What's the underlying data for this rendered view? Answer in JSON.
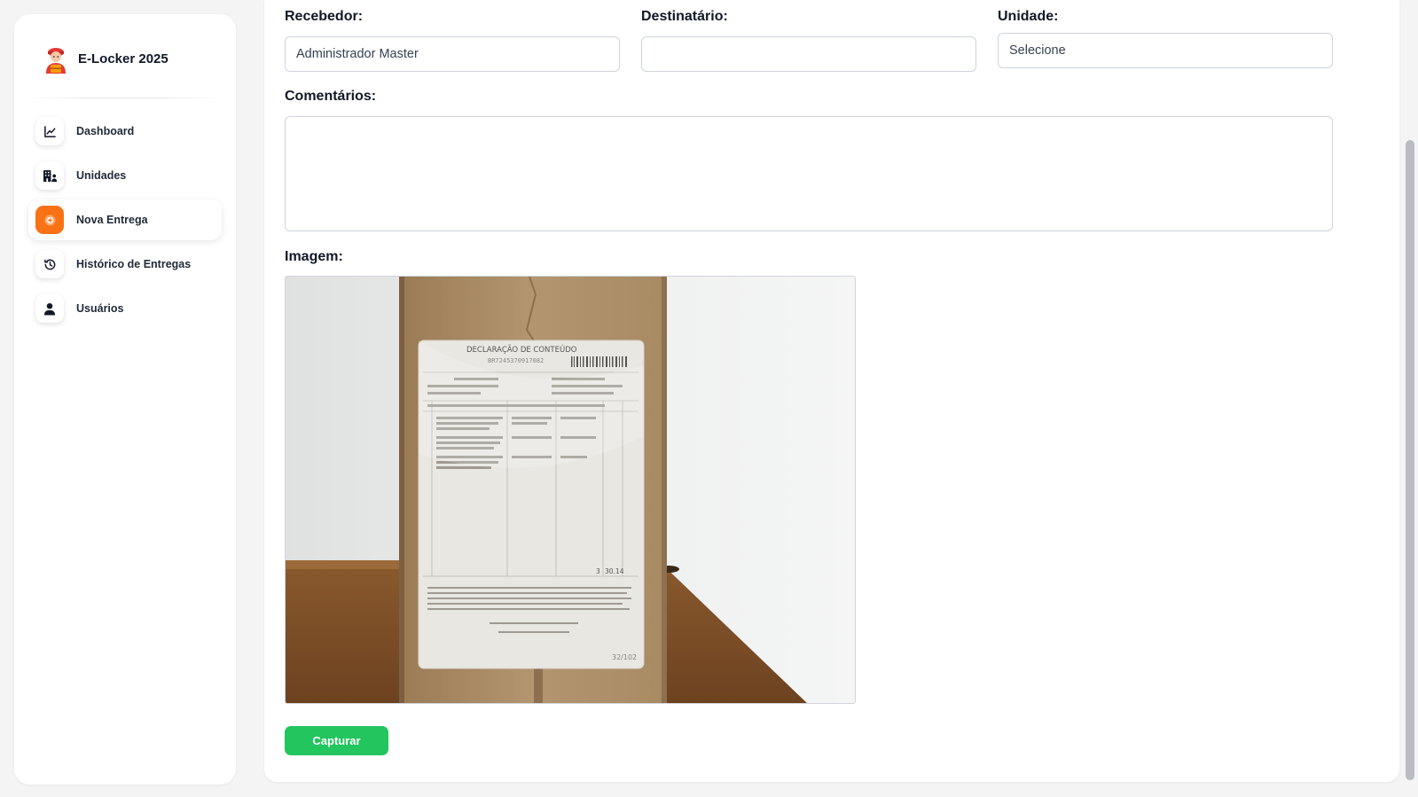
{
  "sidebar": {
    "brand": {
      "title": "E-Locker 2025",
      "logo_icon": "delivery-person-icon"
    },
    "items": [
      {
        "label": "Dashboard",
        "icon": "chart-line-icon",
        "active": false
      },
      {
        "label": "Unidades",
        "icon": "building-users-icon",
        "active": false
      },
      {
        "label": "Nova Entrega",
        "icon": "plus-circle-icon",
        "active": true
      },
      {
        "label": "Histórico de Entregas",
        "icon": "history-icon",
        "active": false
      },
      {
        "label": "Usuários",
        "icon": "user-icon",
        "active": false
      }
    ]
  },
  "form": {
    "recebedor": {
      "label": "Recebedor:",
      "value": "Administrador Master",
      "placeholder": ""
    },
    "destinatario": {
      "label": "Destinatário:",
      "value": "",
      "placeholder": ""
    },
    "unidade": {
      "label": "Unidade:",
      "selected": "Selecione"
    },
    "comentarios": {
      "label": "Comentários:",
      "value": ""
    },
    "imagem": {
      "label": "Imagem:"
    },
    "capture_button": "Capturar"
  },
  "photo": {
    "label_heading": "DECLARAÇÃO DE CONTEÚDO",
    "tracking": "BR7245370917082",
    "footer_value": "30.14",
    "footer_qty": "3",
    "corner_code": "32/102"
  },
  "colors": {
    "accent": "#f97316",
    "capture": "#22c55e",
    "background": "#f4f4f5"
  }
}
